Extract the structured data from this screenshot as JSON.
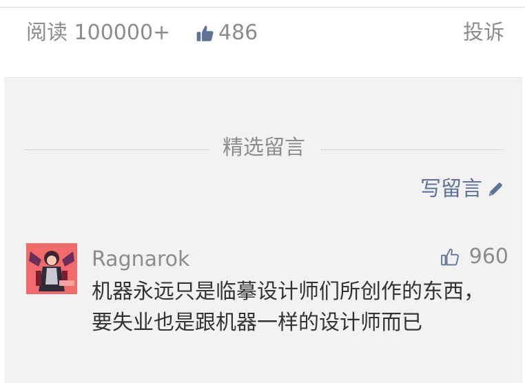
{
  "stats": {
    "read_label": "阅读 100000+",
    "like_count": "486",
    "report_label": "投诉"
  },
  "section": {
    "title": "精选留言",
    "write_comment_label": "写留言"
  },
  "comment": {
    "author": "Ragnarok",
    "like_count": "960",
    "text": "机器永远只是临摹设计师们所创作的东西，要失业也是跟机器一样的设计师而已"
  },
  "colors": {
    "link": "#5e7397",
    "muted": "#8c8c8c",
    "body_text": "#333333",
    "comments_bg": "#f2f2f2",
    "avatar_bg": "#f26b6b"
  },
  "icons": {
    "like_solid": "thumbs-up-solid-icon",
    "like_outline": "thumbs-up-outline-icon",
    "pencil": "pencil-icon"
  }
}
